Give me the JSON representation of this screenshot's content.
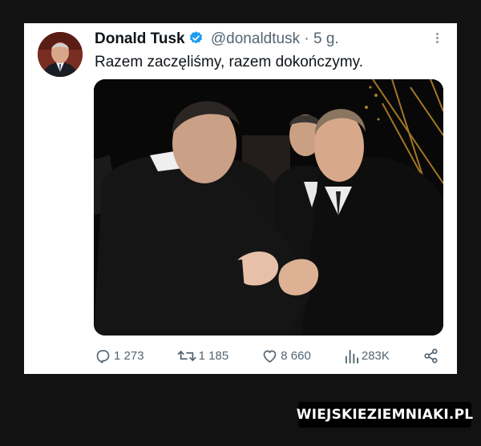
{
  "tweet": {
    "author_name": "Donald Tusk",
    "handle": "@donaldtusk",
    "separator": "·",
    "time": "5 g.",
    "text": "Razem zaczęliśmy, razem dokończymy."
  },
  "actions": {
    "reply_count": "1 273",
    "retweet_count": "1 185",
    "like_count": "8 660",
    "views_count": "283K"
  },
  "icons": {
    "verified": "verified-badge-icon",
    "more": "more-options-icon",
    "reply": "reply-icon",
    "retweet": "retweet-icon",
    "like": "heart-icon",
    "views": "views-icon",
    "share": "share-icon"
  },
  "colors": {
    "verified_badge": "#1d9bf0",
    "secondary_text": "#536471",
    "primary_text": "#0f1419"
  },
  "watermark": "WIEJSKIEZIEMNIAKI.PL"
}
